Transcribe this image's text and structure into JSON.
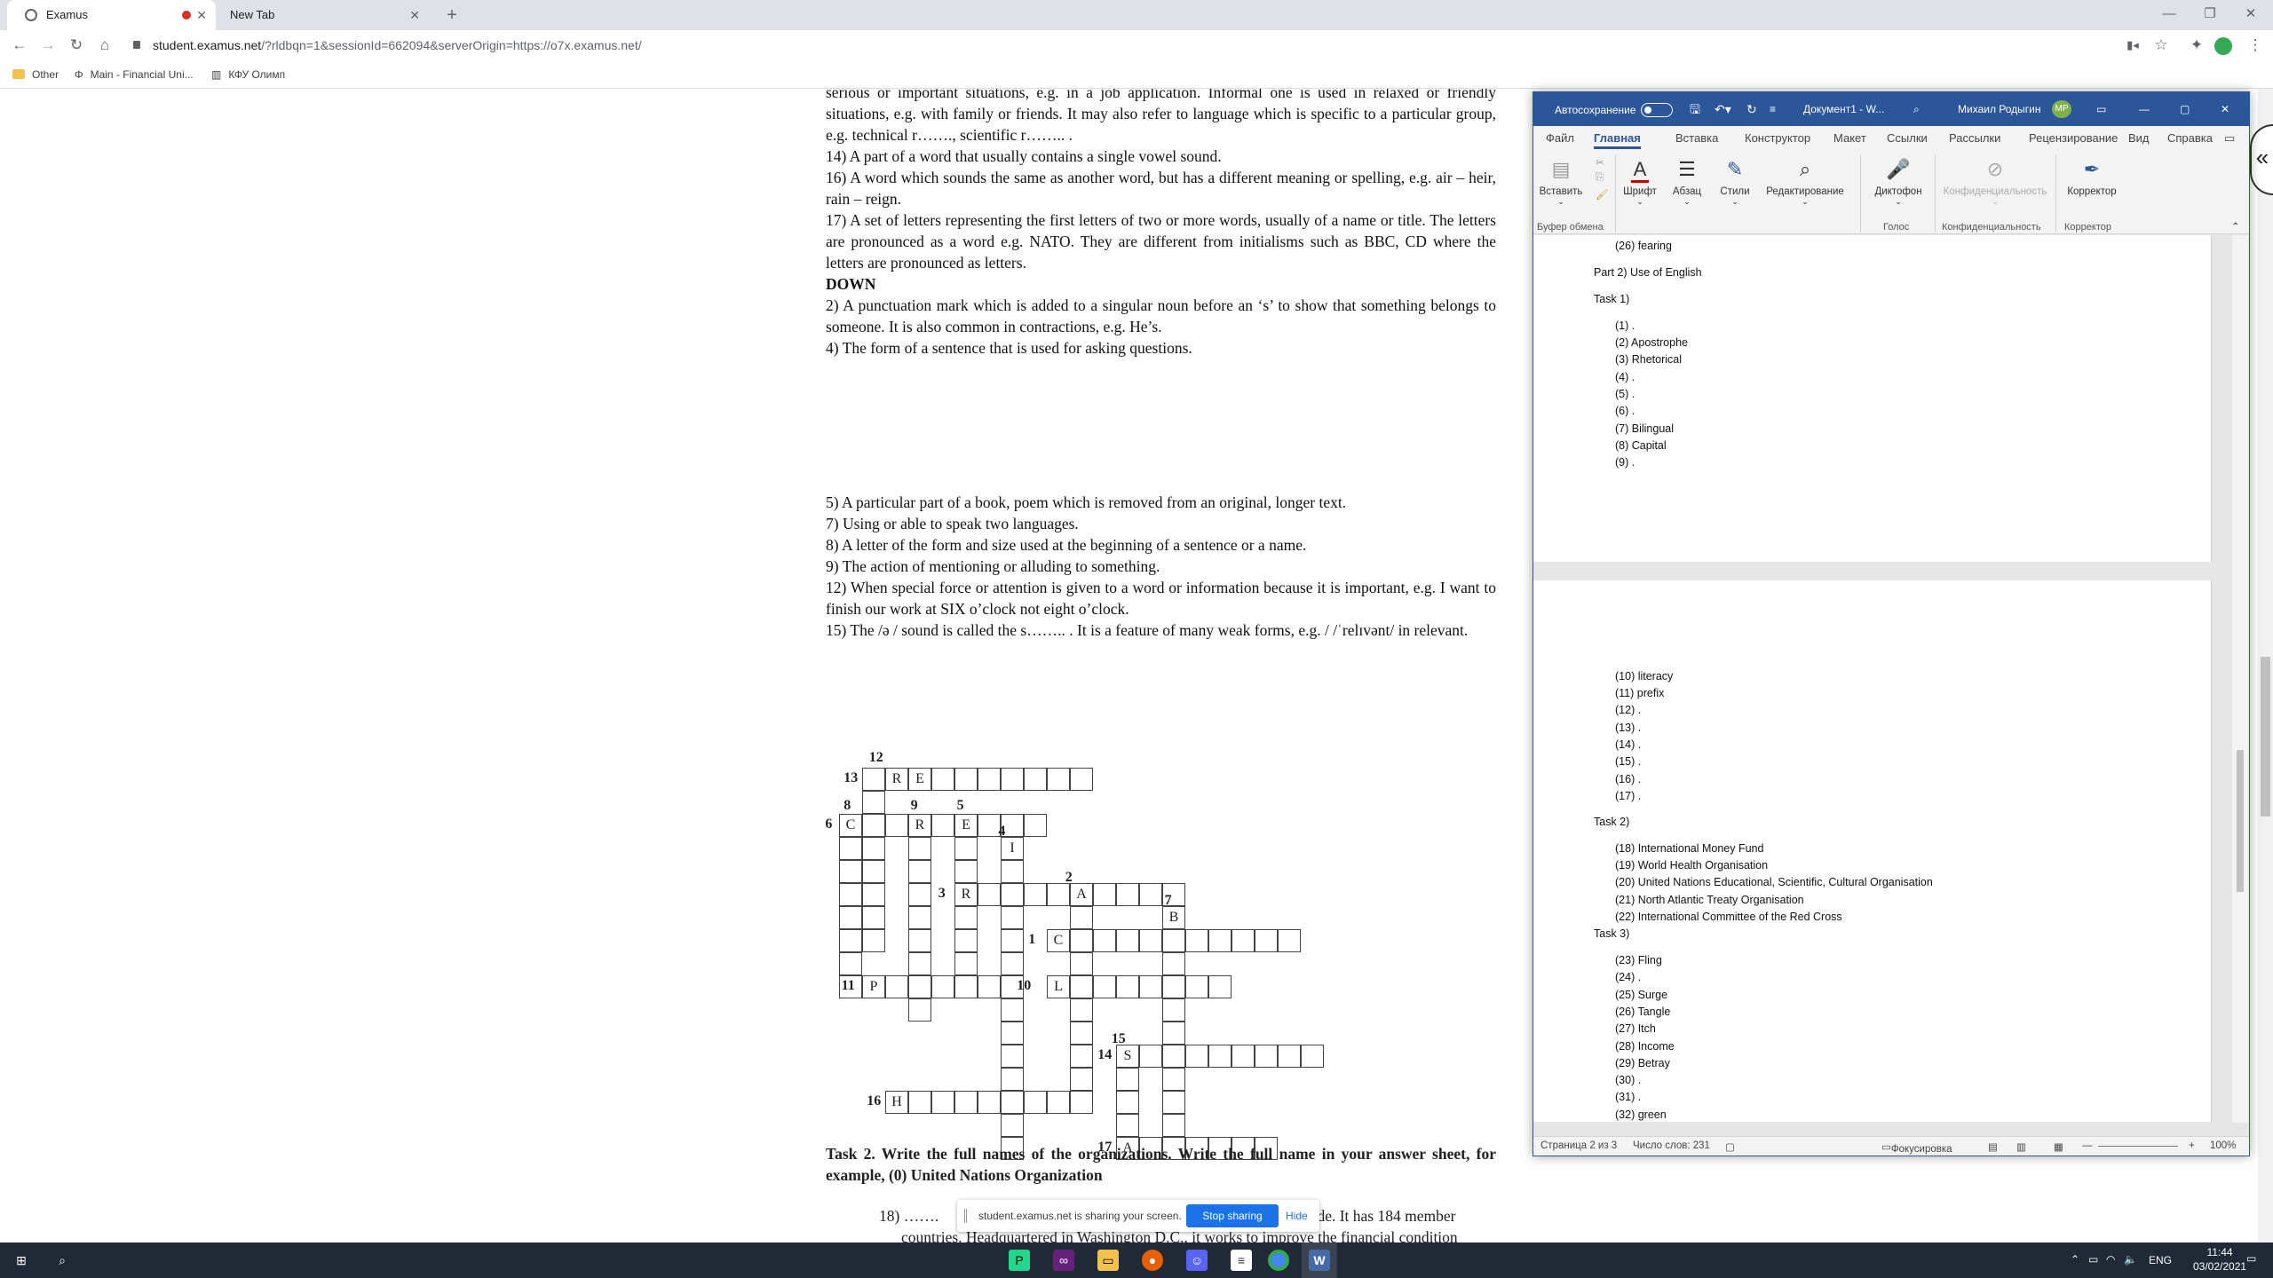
{
  "browser": {
    "tabs": [
      {
        "title": "Examus",
        "active": true
      },
      {
        "title": "New Tab",
        "active": false
      }
    ],
    "url_host": "student.examus.net",
    "url_path": "/?rldbqn=1&sessionId=662094&serverOrigin=https://o7x.examus.net/",
    "bookmarks": [
      "Other",
      "Main - Financial Uni...",
      "КФУ Олимп"
    ]
  },
  "doc": {
    "lines": [
      "serious or important situations, e.g. in a job application. Informal one is used in relaxed or friendly situations, e.g. with family or friends. It may also refer to language which is specific to a particular group, e.g. technical r……., scientific r…….. .",
      "14) A part of a word that usually contains a single vowel sound.",
      "16) A word which sounds the same as another word, but has a different meaning or spelling, e.g. air – heir, rain – reign.",
      "17) A set of letters representing the first letters of two or more words, usually of a name or title. The letters are pronounced as a word e.g. NATO. They are different from initialisms such as BBC, CD where the letters are pronounced as letters.",
      "DOWN",
      "2) A punctuation mark which is added to a singular noun before an ‘s’ to show that something belongs to someone. It is also common in contractions, e.g. He’s.",
      "4) The form of a sentence that is used for asking questions."
    ],
    "lines2": [
      "5) A particular part of a book, poem which is removed from an original, longer text.",
      "7) Using or able to speak two languages.",
      "8) A letter of the form and size used at the beginning of a sentence or a name.",
      "9) The action of mentioning or alluding to something.",
      "12) When special force or attention is given to a word or information because it is important, e.g. I want to finish our work at SIX o’clock not eight  o’clock.",
      "15) The /ə / sound is called the s…….. . It is a feature of many weak forms, e.g. / /ˈrelɪvənt/ in relevant."
    ],
    "task2": "Task 2. Write the full names of the organizations. Write the full name in your answer sheet, for example, (0) United Nations Organization",
    "q18": "18) …….",
    "q18_tail": "trade. It has 184 member",
    "q18b": "countries. Headquartered in Washington D.C., it works to improve the financial condition"
  },
  "crossword": {
    "numbers": [
      "12",
      "13",
      "8",
      "9",
      "5",
      "6",
      "4",
      "2",
      "3",
      "7",
      "1",
      "10",
      "11",
      "15",
      "14",
      "16",
      "17"
    ],
    "letters": [
      "R",
      "E",
      "C",
      "R",
      "E",
      "I",
      "R",
      "A",
      "B",
      "C",
      "L",
      "P",
      "S",
      "H",
      "A"
    ]
  },
  "share": {
    "message": "student.examus.net is sharing your screen.",
    "stop": "Stop sharing",
    "hide": "Hide"
  },
  "word": {
    "autosave": "Автосохранение",
    "doc_title": "Документ1 - W...",
    "user": "Михаил Родыгин",
    "initials": "МР",
    "tabs": [
      "Файл",
      "Главная",
      "Вставка",
      "Конструктор",
      "Макет",
      "Ссылки",
      "Рассылки",
      "Рецензирование",
      "Вид",
      "Справка"
    ],
    "ribbon": {
      "paste": "Вставить",
      "font": "Шрифт",
      "para": "Абзац",
      "styles": "Стили",
      "editing": "Редактирование",
      "dictate": "Диктофон",
      "privacy": "Конфиденциальность",
      "editor": "Корректор"
    },
    "groups": {
      "clipboard": "Буфер обмена",
      "voice": "Голос",
      "privacy": "Конфиденциальность",
      "editor": "Корректор"
    },
    "page1": [
      "(26) fearing",
      "Part 2) Use of English",
      "Task 1)",
      "(1)  .",
      "(2)  Apostrophe",
      "(3)  Rhetorical",
      "(4)  .",
      "(5)  .",
      "(6)  .",
      "(7)  Bilingual",
      "(8)  Capital",
      "(9)  ."
    ],
    "page2": [
      "(10) literacy",
      "(11) prefix",
      "(12) .",
      "(13) .",
      "(14) .",
      "(15) .",
      "(16) .",
      "(17) .",
      "Task 2)",
      "(18) International Money Fund",
      "(19) World Health Organisation",
      "(20) United Nations Educational, Scientific, Cultural Organisation",
      "(21) North Atlantic Treaty Organisation",
      "(22) International Committee of the Red Cross",
      "Task 3)",
      "(23) Fling",
      "(24) .",
      "(25) Surge",
      "(26) Tangle",
      "(27) Itch",
      "(28) Income",
      "(29) Betray",
      "(30) .",
      "(31) .",
      "(32) green"
    ],
    "status": {
      "page": "Страница 2 из 3",
      "words": "Число слов: 231",
      "focus": "Фокусировка",
      "zoom": "100%"
    }
  },
  "taskbar": {
    "lang": "ENG",
    "time": "11:44",
    "date": "03/02/2021"
  }
}
